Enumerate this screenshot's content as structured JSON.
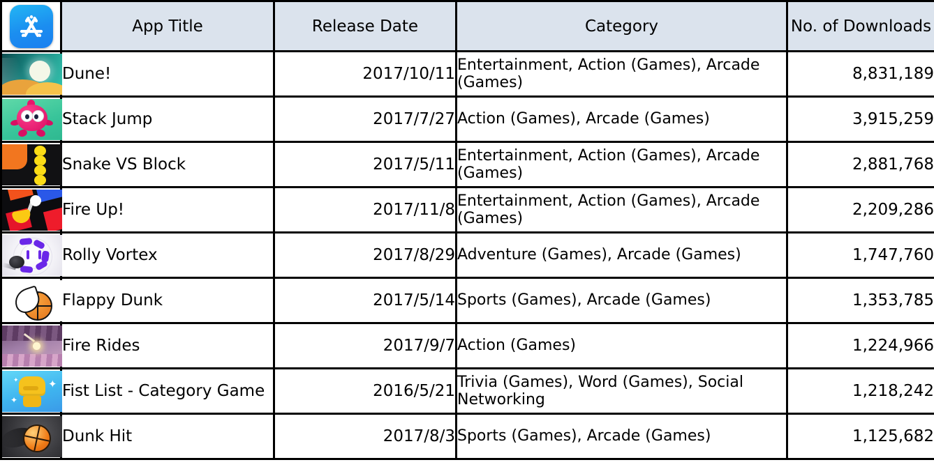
{
  "logo": {
    "name": "app-store-icon",
    "color": "#1b8ef0"
  },
  "table": {
    "header_bg": "#dbe3ed",
    "border_color": "#000000",
    "columns": [
      {
        "key": "icon",
        "label": ""
      },
      {
        "key": "title",
        "label": "App Title"
      },
      {
        "key": "date",
        "label": "Release Date"
      },
      {
        "key": "cat",
        "label": "Category"
      },
      {
        "key": "dl",
        "label": "No. of Downloads"
      }
    ],
    "rows": [
      {
        "icon": "dune-app-icon",
        "title": "Dune!",
        "date": "2017/10/11",
        "category": "Entertainment, Action (Games), Arcade (Games)",
        "downloads": "8,831,189"
      },
      {
        "icon": "stack-jump-app-icon",
        "title": "Stack Jump",
        "date": "2017/7/27",
        "category": "Action (Games), Arcade (Games)",
        "downloads": "3,915,259"
      },
      {
        "icon": "snake-vs-block-app-icon",
        "title": "Snake VS Block",
        "date": "2017/5/11",
        "category": "Entertainment, Action (Games), Arcade (Games)",
        "downloads": "2,881,768"
      },
      {
        "icon": "fire-up-app-icon",
        "title": "Fire Up!",
        "date": "2017/11/8",
        "category": "Entertainment, Action (Games), Arcade (Games)",
        "downloads": "2,209,286"
      },
      {
        "icon": "rolly-vortex-app-icon",
        "title": "Rolly Vortex",
        "date": "2017/8/29",
        "category": "Adventure (Games), Arcade (Games)",
        "downloads": "1,747,760"
      },
      {
        "icon": "flappy-dunk-app-icon",
        "title": "Flappy Dunk",
        "date": "2017/5/14",
        "category": "Sports (Games), Arcade (Games)",
        "downloads": "1,353,785"
      },
      {
        "icon": "fire-rides-app-icon",
        "title": "Fire Rides",
        "date": "2017/9/7",
        "category": "Action (Games)",
        "downloads": "1,224,966"
      },
      {
        "icon": "fist-list-app-icon",
        "title": "Fist List - Category Game",
        "date": "2016/5/21",
        "category": "Trivia (Games), Word (Games), Social Networking",
        "downloads": "1,218,242"
      },
      {
        "icon": "dunk-hit-app-icon",
        "title": "Dunk Hit",
        "date": "2017/8/3",
        "category": "Sports (Games), Arcade (Games)",
        "downloads": "1,125,682"
      }
    ]
  }
}
